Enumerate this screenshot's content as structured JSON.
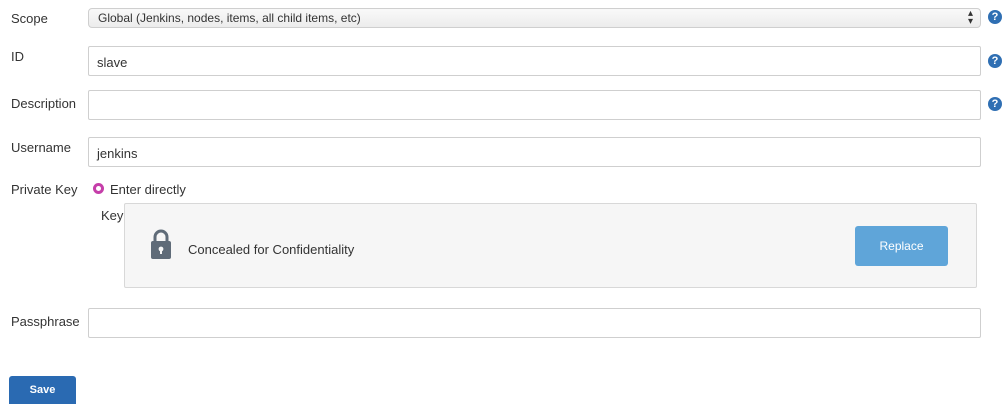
{
  "form": {
    "scope": {
      "label": "Scope",
      "value": "Global (Jenkins, nodes, items, all child items, etc)"
    },
    "id": {
      "label": "ID",
      "value": "slave"
    },
    "description": {
      "label": "Description",
      "value": ""
    },
    "username": {
      "label": "Username",
      "value": "jenkins"
    },
    "private_key": {
      "label": "Private Key",
      "option_label": "Enter directly",
      "key_label": "Key",
      "concealed_text": "Concealed for Confidentiality",
      "replace_label": "Replace"
    },
    "passphrase": {
      "label": "Passphrase",
      "value": ""
    },
    "save_label": "Save",
    "help_symbol": "?"
  },
  "colors": {
    "help_icon": "#2f6fb3",
    "radio_selected": "#c53ea9",
    "replace_button": "#5fa5d9",
    "save_button": "#2a6ab2"
  },
  "icons": {
    "help": "help-icon",
    "lock": "lock-icon",
    "select_arrows": "select-arrows-icon"
  }
}
